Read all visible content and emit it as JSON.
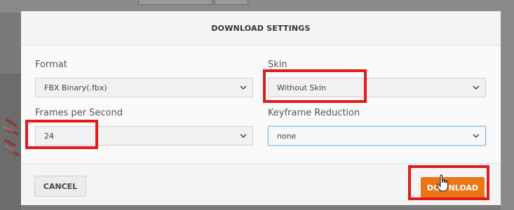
{
  "dialog": {
    "title": "DOWNLOAD SETTINGS"
  },
  "fields": {
    "format": {
      "label": "Format",
      "value": "FBX Binary(.fbx)"
    },
    "skin": {
      "label": "Skin",
      "value": "Without Skin"
    },
    "fps": {
      "label": "Frames per Second",
      "value": "24"
    },
    "keyframe_reduction": {
      "label": "Keyframe Reduction",
      "value": "none"
    }
  },
  "footer": {
    "cancel_label": "CANCEL",
    "download_label": "DOWNLOAD"
  },
  "colors": {
    "accent": "#ec7616",
    "highlight": "#e01b1b",
    "focus": "#7fbfe6"
  },
  "icons": [
    "chevron-down-icon",
    "hand-cursor-icon"
  ]
}
